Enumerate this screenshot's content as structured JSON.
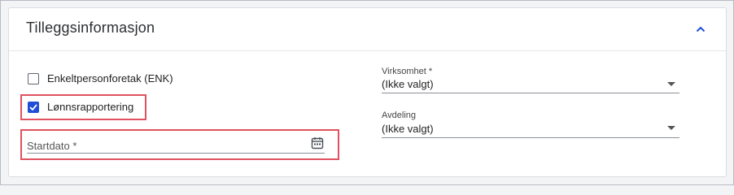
{
  "panel": {
    "title": "Tilleggsinformasjon",
    "collapse_icon": "chevron-up-icon",
    "accent": "#1f4fd6",
    "highlight_color": "#e0525f"
  },
  "left": {
    "enk": {
      "label": "Enkeltpersonforetak (ENK)",
      "checked": false
    },
    "payroll": {
      "label": "Lønnsrapportering",
      "checked": true
    },
    "startdate": {
      "placeholder": "Startdato *",
      "value": "",
      "icon": "calendar-icon"
    }
  },
  "right": {
    "virksomhet": {
      "label": "Virksomhet *",
      "value": "(Ikke valgt)"
    },
    "avdeling": {
      "label": "Avdeling",
      "value": "(Ikke valgt)"
    }
  }
}
